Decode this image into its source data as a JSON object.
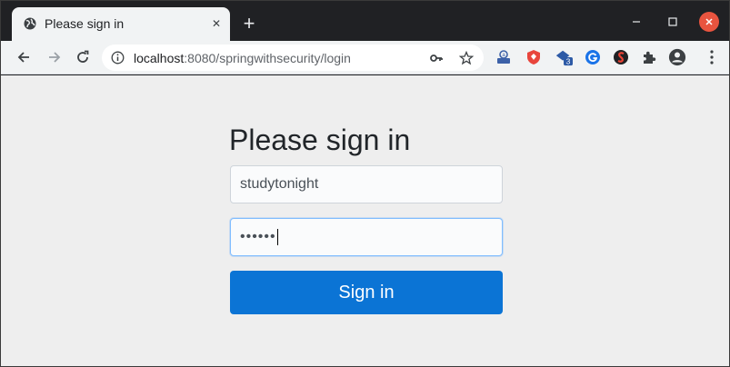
{
  "browser": {
    "tab": {
      "title": "Please sign in",
      "close_glyph": "✕",
      "icon": "globe-icon"
    },
    "new_tab_glyph": "+",
    "window_controls": {
      "minimize_glyph": "–",
      "maximize_glyph": "☐",
      "close_glyph": "✕"
    },
    "address": {
      "host": "localhost",
      "rest": ":8080/springwithsecurity/login"
    },
    "extensions": [
      {
        "name": "extension-a-icon",
        "color": "#3c61a8"
      },
      {
        "name": "extension-shield-icon",
        "color": "#e8453c"
      },
      {
        "name": "extension-badge-icon",
        "color": "#2d5aa6",
        "badge": "3"
      },
      {
        "name": "extension-g-icon",
        "color": "#1a73e8"
      },
      {
        "name": "extension-s-icon",
        "color": "#d93025"
      },
      {
        "name": "extensions-puzzle-icon",
        "color": "#3c4043"
      },
      {
        "name": "profile-avatar-icon",
        "color": "#3c4043"
      }
    ]
  },
  "page": {
    "heading": "Please sign in",
    "username_value": "studytonight",
    "password_value": "••••••",
    "submit_label": "Sign in"
  },
  "colors": {
    "primary_button": "#0b74d5",
    "page_background": "#eeeeee"
  }
}
